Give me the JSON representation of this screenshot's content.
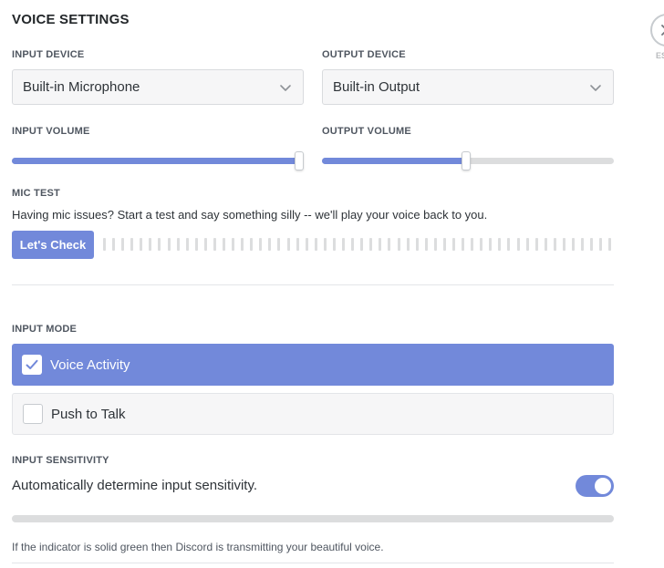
{
  "title": "VOICE SETTINGS",
  "close": {
    "hint": "ESC"
  },
  "input_device": {
    "label": "INPUT DEVICE",
    "value": "Built-in Microphone"
  },
  "output_device": {
    "label": "OUTPUT DEVICE",
    "value": "Built-in Output"
  },
  "input_volume": {
    "label": "INPUT VOLUME",
    "level_fraction": 1.0
  },
  "output_volume": {
    "label": "OUTPUT VOLUME",
    "level_fraction": 0.5
  },
  "mic_test": {
    "label": "MIC TEST",
    "description": "Having mic issues? Start a test and say something silly -- we'll play your voice back to you.",
    "button": "Let's Check"
  },
  "input_mode": {
    "label": "INPUT MODE",
    "options": [
      {
        "label": "Voice Activity",
        "selected": true
      },
      {
        "label": "Push to Talk",
        "selected": false
      }
    ]
  },
  "input_sensitivity": {
    "label": "INPUT SENSITIVITY",
    "auto_label": "Automatically determine input sensitivity.",
    "auto_enabled": true,
    "footnote": "If the indicator is solid green then Discord is transmitting your beautiful voice."
  },
  "colors": {
    "accent": "#7289da",
    "track": "#dcddde",
    "divider": "#e3e5e8"
  },
  "icons": {
    "dropdown": "chevron-down-icon",
    "check": "checkmark-icon",
    "close": "close-icon"
  }
}
